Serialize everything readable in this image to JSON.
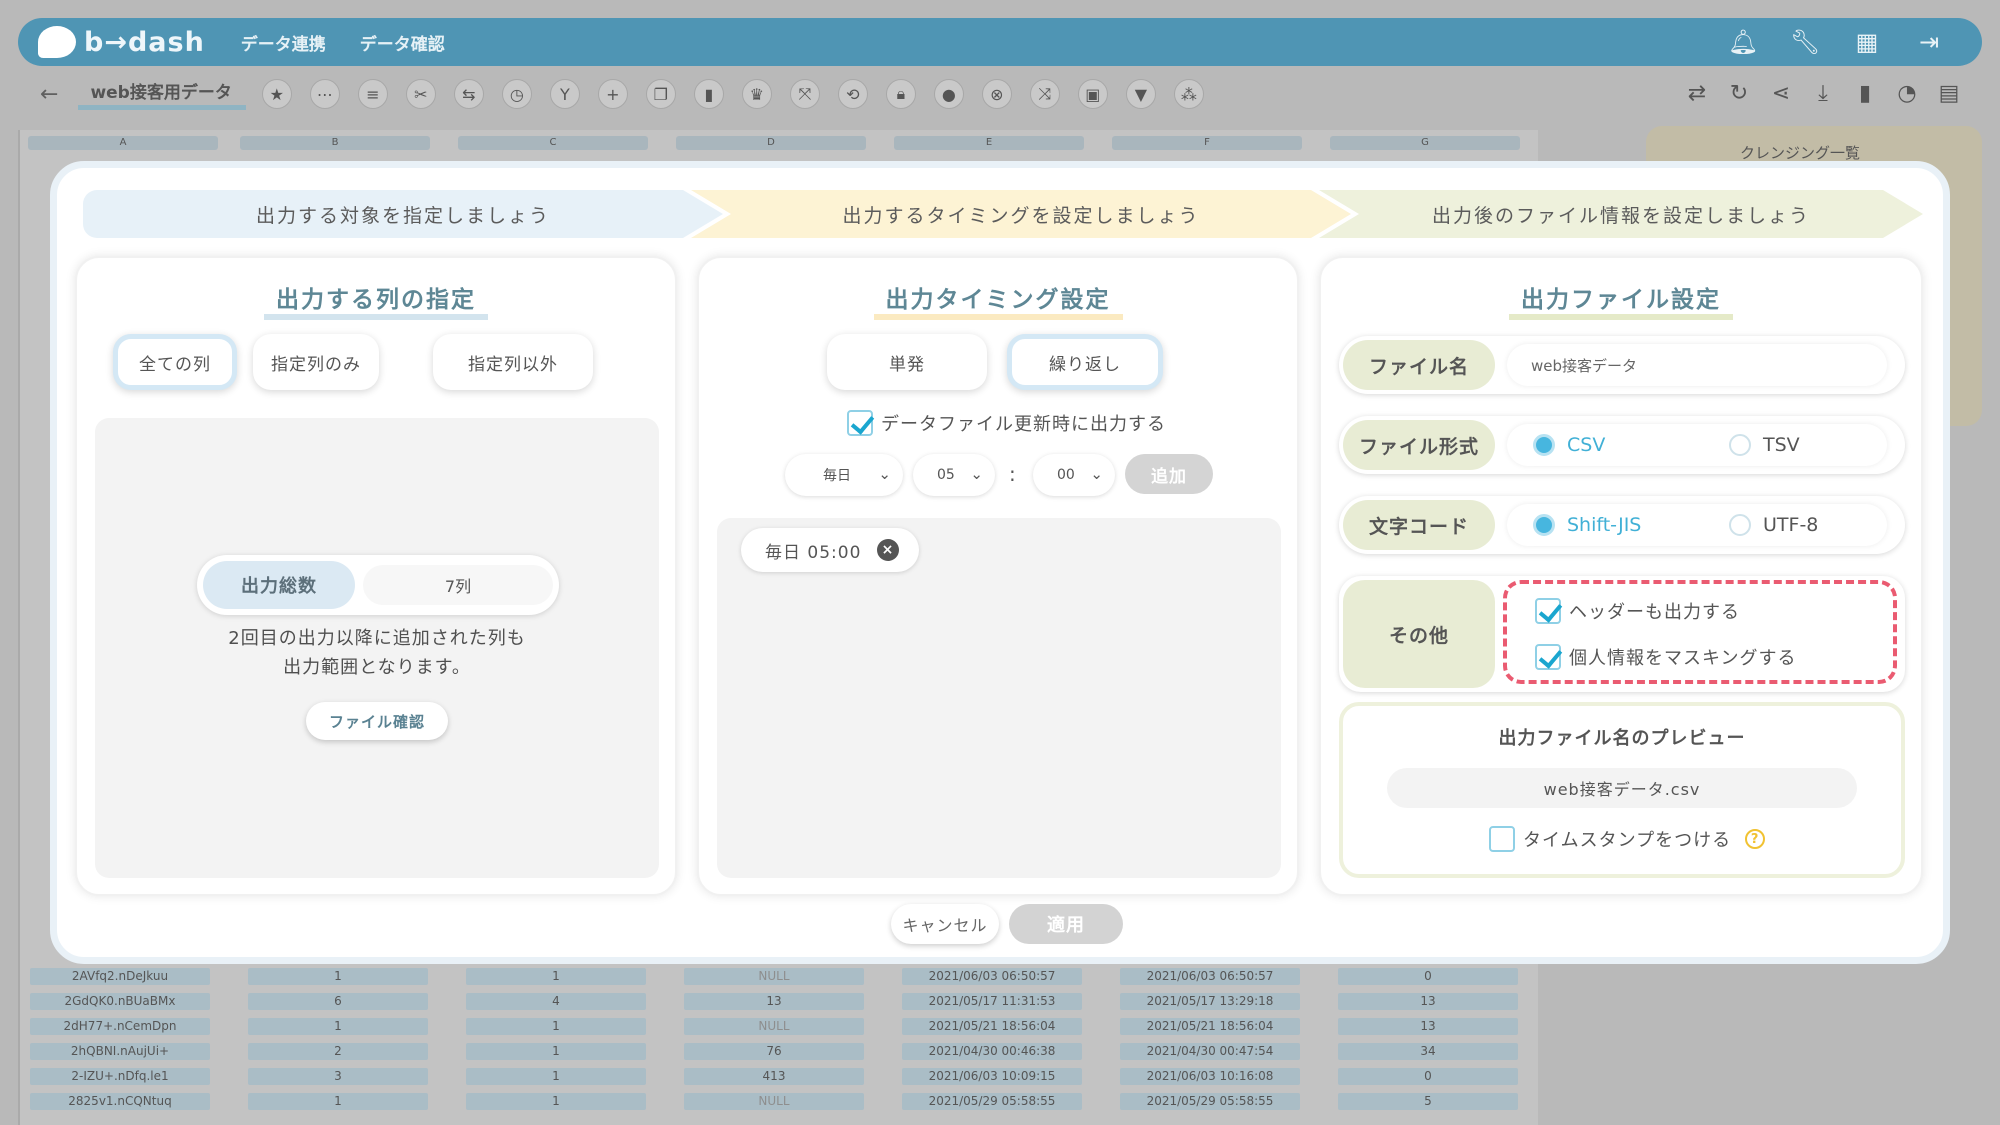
{
  "app": {
    "logo": "b→dash",
    "nav": [
      "データ連携",
      "データ確認"
    ],
    "dataset_name": "web接客用データ",
    "right_panel_title": "クレンジング一覧"
  },
  "sheet": {
    "column_letters": [
      "A",
      "B",
      "C",
      "D",
      "E",
      "F",
      "G"
    ],
    "rows": [
      [
        "2AVfq2.nDeJkuu",
        "1",
        "1",
        "NULL",
        "2021/06/03 06:50:57",
        "2021/06/03 06:50:57",
        "0"
      ],
      [
        "2GdQK0.nBUaBMx",
        "6",
        "4",
        "13",
        "2021/05/17 11:31:53",
        "2021/05/17 13:29:18",
        "13"
      ],
      [
        "2dH77+.nCemDpn",
        "1",
        "1",
        "NULL",
        "2021/05/21 18:56:04",
        "2021/05/21 18:56:04",
        "13"
      ],
      [
        "2hQBNI.nAujUi+",
        "2",
        "1",
        "76",
        "2021/04/30 00:46:38",
        "2021/04/30 00:47:54",
        "34"
      ],
      [
        "2-IZU+.nDfq.le1",
        "3",
        "1",
        "413",
        "2021/06/03 10:09:15",
        "2021/06/03 10:16:08",
        "0"
      ],
      [
        "2825v1.nCQNtuq",
        "1",
        "1",
        "NULL",
        "2021/05/29 05:58:55",
        "2021/05/29 05:58:55",
        "5"
      ]
    ]
  },
  "modal": {
    "steps": [
      "出力する対象を指定しましょう",
      "出力するタイミングを設定しましょう",
      "出力後のファイル情報を設定しましょう"
    ],
    "columns_panel": {
      "title": "出力する列の指定",
      "options": [
        "全ての列",
        "指定列のみ",
        "指定列以外"
      ],
      "selected": "全ての列",
      "total_label": "出力総数",
      "total_value": "7列",
      "note_line1": "2回目の出力以降に追加された列も",
      "note_line2": "出力範囲となります。",
      "file_check": "ファイル確認"
    },
    "timing_panel": {
      "title": "出力タイミング設定",
      "options": [
        "単発",
        "繰り返し"
      ],
      "selected": "繰り返し",
      "update_checkbox": "データファイル更新時に出力する",
      "update_checked": true,
      "frequency": "毎日",
      "hour": "05",
      "minute": "00",
      "add": "追加",
      "schedules": [
        "毎日 05:00"
      ]
    },
    "file_panel": {
      "title": "出力ファイル設定",
      "filename_label": "ファイル名",
      "filename_value": "web接客データ",
      "format_label": "ファイル形式",
      "format_options": [
        "CSV",
        "TSV"
      ],
      "format_selected": "CSV",
      "encoding_label": "文字コード",
      "encoding_options": [
        "Shift-JIS",
        "UTF-8"
      ],
      "encoding_selected": "Shift-JIS",
      "other_label": "その他",
      "header_option": "ヘッダーも出力する",
      "header_checked": true,
      "mask_option": "個人情報をマスキングする",
      "mask_checked": true,
      "preview_title": "出力ファイル名のプレビュー",
      "preview_value": "web接客データ.csv",
      "timestamp_option": "タイムスタンプをつける",
      "timestamp_checked": false
    },
    "cancel": "キャンセル",
    "apply": "適用"
  },
  "colors": {
    "topbar": "#4f95b4",
    "accent": "#41b0d6",
    "highlight_dash": "#ea5b71"
  }
}
